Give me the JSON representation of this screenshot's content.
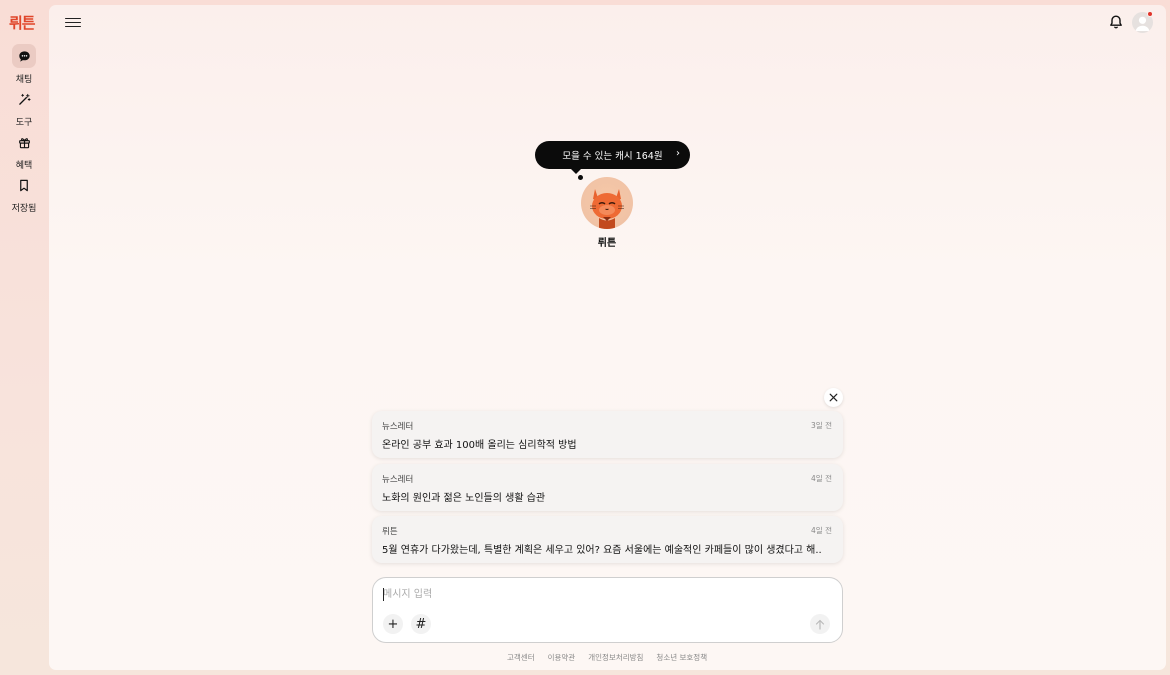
{
  "brand": {
    "logo": "뤼튼",
    "color": "#e0452a"
  },
  "sidebar": {
    "items": [
      {
        "label": "채팅",
        "icon": "chat-icon",
        "active": true
      },
      {
        "label": "도구",
        "icon": "magic-wand-icon",
        "active": false
      },
      {
        "label": "혜택",
        "icon": "gift-icon",
        "active": false
      },
      {
        "label": "저장됨",
        "icon": "bookmark-icon",
        "active": false
      }
    ]
  },
  "header": {
    "menu_icon": "hamburger-menu-icon",
    "bell_icon": "bell-icon",
    "avatar_icon": "user-avatar-icon",
    "notification_dot_color": "#e0342a"
  },
  "hero": {
    "cash_bubble": "모을 수 있는 캐시 164원",
    "character_name": "뤼튼"
  },
  "recent": {
    "items": [
      {
        "source": "뉴스레터",
        "time": "3일 전",
        "title": "온라인 공부 효과 100배 올리는 심리학적 방법"
      },
      {
        "source": "뉴스레터",
        "time": "4일 전",
        "title": "노화의 원인과 젊은 노인들의 생활 습관"
      },
      {
        "source": "뤼튼",
        "time": "4일 전",
        "title": "5월 연휴가 다가왔는데, 특별한 계획은 세우고 있어? 요즘 서울에는 예술적인 카페들이 많이 생겼다고 해...."
      }
    ]
  },
  "composer": {
    "placeholder": "메시지 입력",
    "add_label": "+",
    "hashtag_label": "#"
  },
  "footer": {
    "links": [
      "고객센터",
      "이용약관",
      "개인정보처리방침",
      "청소년 보호정책"
    ]
  }
}
